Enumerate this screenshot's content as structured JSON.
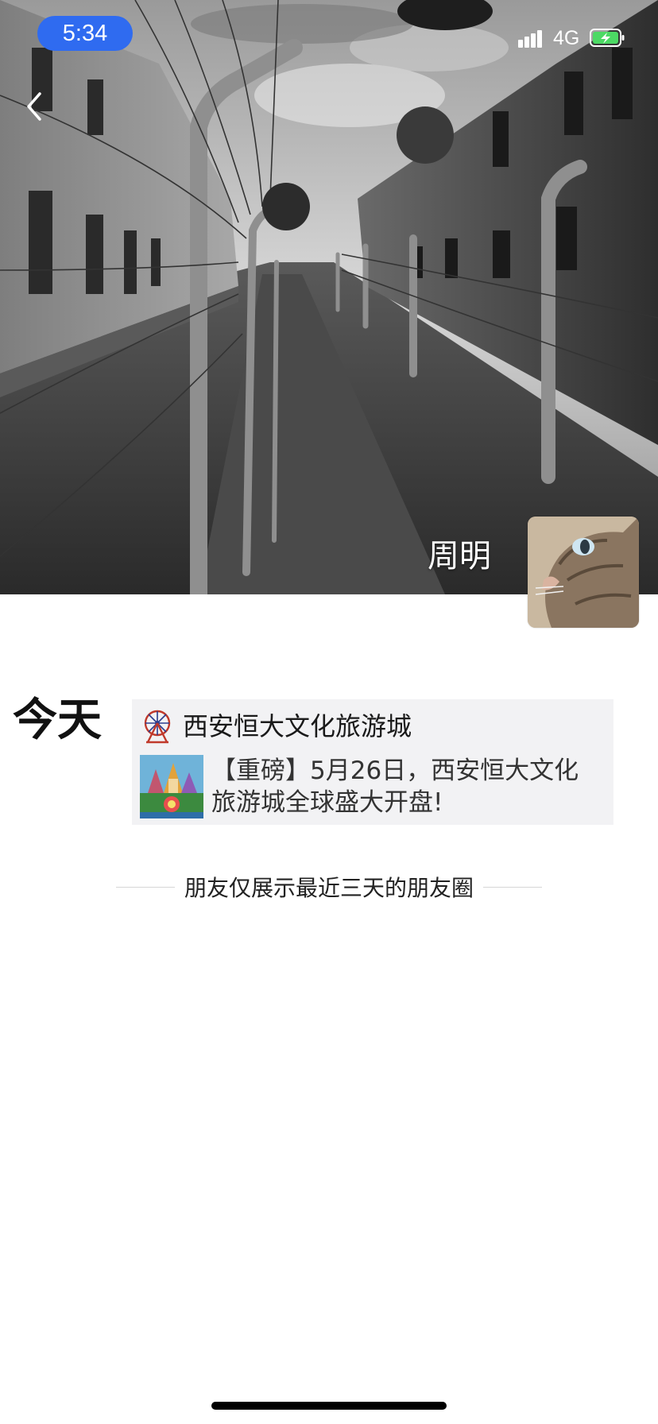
{
  "status_bar": {
    "time": "5:34",
    "network": "4G",
    "time_badge_color": "#2f6bf0",
    "battery_color": "#4cd964"
  },
  "profile": {
    "name": "周明"
  },
  "feed": {
    "day_label": "今天",
    "posts": [
      {
        "source_name": "西安恒大文化旅游城",
        "text": "【重磅】5月26日，西安恒大文化旅游城全球盛大开盘!"
      }
    ],
    "notice": "朋友仅展示最近三天的朋友圈"
  }
}
